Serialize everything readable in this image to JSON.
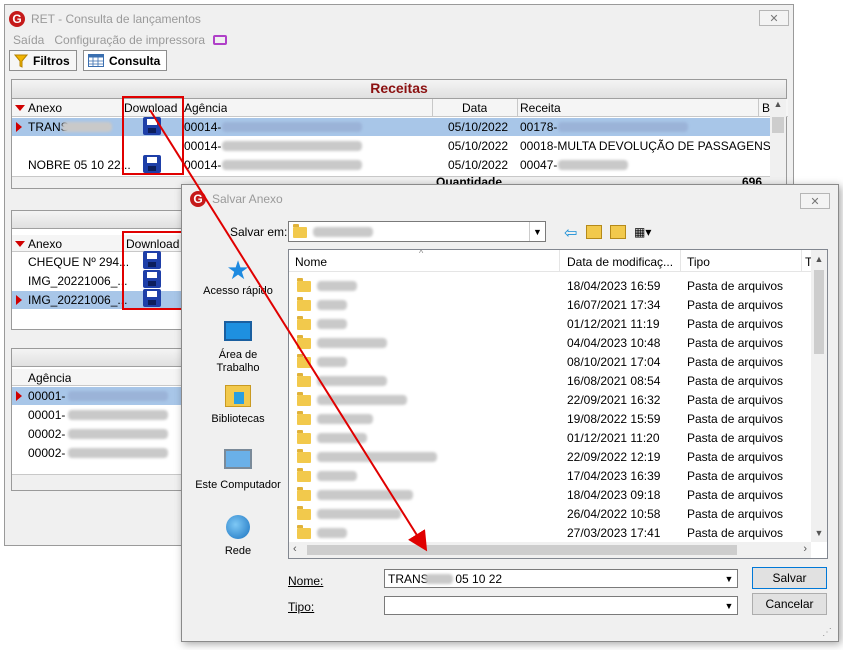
{
  "main_window": {
    "title": "RET - Consulta de lançamentos",
    "close": "✕",
    "menu": [
      "Saída",
      "Configuração de impressora"
    ],
    "tabs": {
      "filtros": "Filtros",
      "consulta": "Consulta"
    },
    "receitas": {
      "heading": "Receitas",
      "columns": [
        "Anexo",
        "Download",
        "Agência",
        "Data",
        "Receita",
        "B"
      ],
      "rows": [
        {
          "anexo": "TRANS",
          "agencia": "00014-",
          "data": "05/10/2022",
          "receita": "00178-"
        },
        {
          "anexo": "",
          "agencia": "00014-",
          "data": "05/10/2022",
          "receita": "00018-MULTA DEVOLUÇÃO DE PASSAGENS"
        },
        {
          "anexo": "NOBRE 05 10 22...",
          "agencia": "00014-",
          "data": "05/10/2022",
          "receita": "00047-"
        }
      ],
      "quantidade_label": "Quantidade",
      "quantidade_value": "696"
    },
    "anexos": {
      "columns": [
        "Anexo",
        "Download"
      ],
      "rows": [
        "CHEQUE Nº 294...",
        "IMG_20221006_...",
        "IMG_20221006_..."
      ]
    },
    "agencias": {
      "columns": [
        "Agência"
      ],
      "rows": [
        "00001-",
        "00001-",
        "00002-",
        "00002-"
      ]
    }
  },
  "save_dialog": {
    "title": "Salvar Anexo",
    "close": "✕",
    "save_in_label": "Salvar em:",
    "columns": {
      "nome": "Nome",
      "data": "Data de modificaç...",
      "tipo": "Tipo",
      "extra": "T"
    },
    "places": [
      "Acesso rápido",
      "Área de Trabalho",
      "Bibliotecas",
      "Este Computador",
      "Rede"
    ],
    "files": [
      {
        "date": "18/04/2023 16:59",
        "type": "Pasta de arquivos"
      },
      {
        "date": "16/07/2021 17:34",
        "type": "Pasta de arquivos"
      },
      {
        "date": "01/12/2021 11:19",
        "type": "Pasta de arquivos"
      },
      {
        "date": "04/04/2023 10:48",
        "type": "Pasta de arquivos"
      },
      {
        "date": "08/10/2021 17:04",
        "type": "Pasta de arquivos"
      },
      {
        "date": "16/08/2021 08:54",
        "type": "Pasta de arquivos"
      },
      {
        "date": "22/09/2021 16:32",
        "type": "Pasta de arquivos"
      },
      {
        "date": "19/08/2022 15:59",
        "type": "Pasta de arquivos"
      },
      {
        "date": "01/12/2021 11:20",
        "type": "Pasta de arquivos"
      },
      {
        "date": "22/09/2022 12:19",
        "type": "Pasta de arquivos"
      },
      {
        "date": "17/04/2023 16:39",
        "type": "Pasta de arquivos"
      },
      {
        "date": "18/04/2023 09:18",
        "type": "Pasta de arquivos"
      },
      {
        "date": "26/04/2022 10:58",
        "type": "Pasta de arquivos"
      },
      {
        "date": "27/03/2023 17:41",
        "type": "Pasta de arquivos"
      }
    ],
    "name_label": "Nome:",
    "name_value": "TRANS        05 10 22",
    "type_label": "Tipo:",
    "type_value": "",
    "save_button": "Salvar",
    "cancel_button": "Cancelar"
  },
  "colors": {
    "accent_red": "#e00000",
    "selection": "#cce8ff",
    "brand": "#c51a1a"
  },
  "icons": [
    "filter-icon",
    "calendar-grid-icon",
    "floppy-disk-icon",
    "folder-icon",
    "star-icon",
    "monitor-icon",
    "library-icon",
    "computer-icon",
    "network-icon"
  ]
}
